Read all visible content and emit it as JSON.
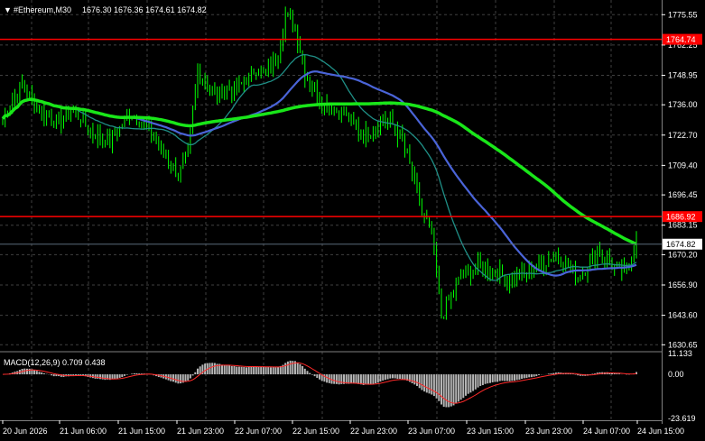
{
  "header": {
    "symbol_text": "#Ethereum,M30",
    "ohlc_text": "1676.30 1676.36 1674.61 1674.82"
  },
  "price_axis": {
    "labels": [
      "1775.55",
      "1762.25",
      "1748.95",
      "1736.00",
      "1722.70",
      "1709.40",
      "1696.45",
      "1683.15",
      "1670.20",
      "1656.90",
      "1643.60",
      "1630.65"
    ],
    "levels": [
      {
        "text": "1764.74",
        "value": 1764.74,
        "bg": "#ff0000"
      },
      {
        "text": "1686.92",
        "value": 1686.92,
        "bg": "#ff0000"
      },
      {
        "text": "1674.82",
        "value": 1674.82,
        "bg": "#ffffff"
      }
    ]
  },
  "macd_panel": {
    "label": "MACD(12,26,9) 0.709 0.438",
    "axis_labels": [
      "11.133",
      "0.00",
      "-23.619"
    ]
  },
  "time_axis": {
    "labels": [
      "20 Jun 2026",
      "21 Jun 06:00",
      "21 Jun 15:00",
      "21 Jun 23:00",
      "22 Jun 07:00",
      "22 Jun 15:00",
      "22 Jun 23:00",
      "23 Jun 07:00",
      "23 Jun 15:00",
      "23 Jun 23:00",
      "24 Jun 07:00",
      "24 Jun 15:00"
    ]
  },
  "colors": {
    "background": "#000000",
    "grid": "#404040",
    "candle": "#00ff00",
    "ma_fast": "#1f8f86",
    "ma_slow": "#4a64d8",
    "ma_long": "#19e619",
    "level_line": "#ff0000",
    "histogram": "#b5b5b5",
    "signal": "#ff2a2a"
  },
  "chart_data": {
    "type": "candlestick",
    "title": "#Ethereum,M30",
    "ylim": [
      1628,
      1782
    ],
    "close_anchors": [
      1730,
      1738,
      1745,
      1738,
      1733,
      1730,
      1728,
      1734,
      1730,
      1724,
      1722,
      1720,
      1726,
      1733,
      1730,
      1725,
      1718,
      1712,
      1705,
      1715,
      1750,
      1745,
      1740,
      1744,
      1742,
      1747,
      1752,
      1750,
      1755,
      1775,
      1770,
      1750,
      1742,
      1736,
      1734,
      1732,
      1728,
      1722,
      1726,
      1730,
      1727,
      1720,
      1706,
      1688,
      1680,
      1643,
      1652,
      1660,
      1663,
      1666,
      1664,
      1662,
      1658,
      1661,
      1662,
      1666,
      1668,
      1670,
      1665,
      1660,
      1666,
      1672,
      1668,
      1664,
      1662,
      1678
    ]
  }
}
